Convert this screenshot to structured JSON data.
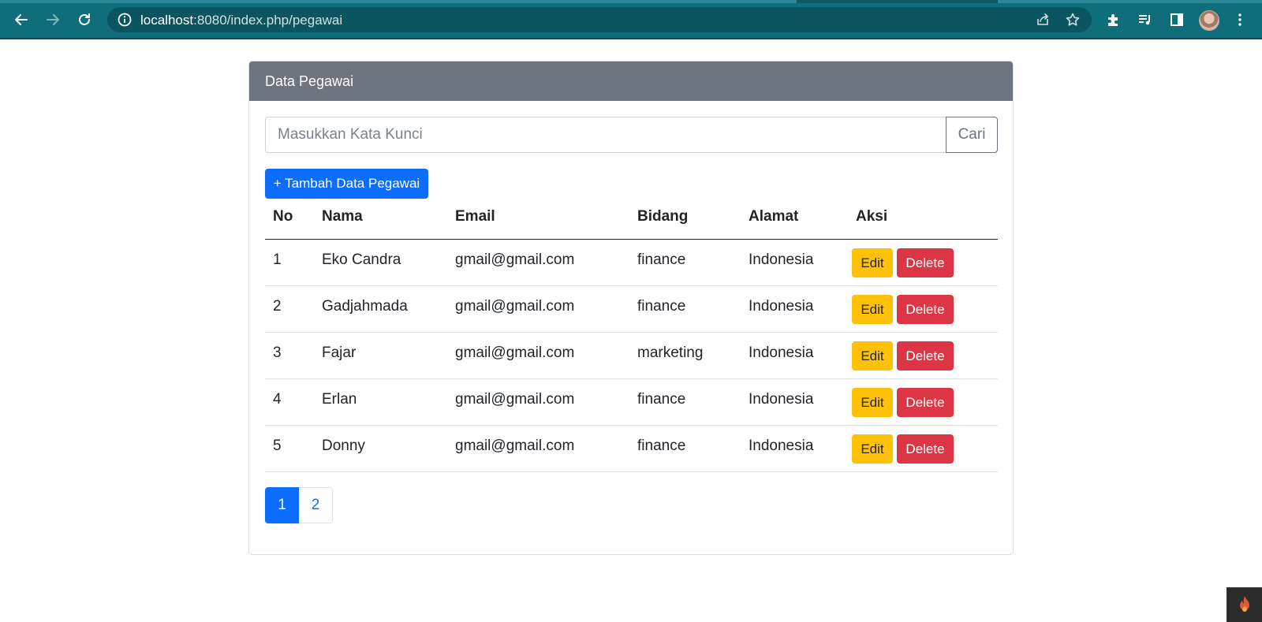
{
  "browser": {
    "url_host": "localhost",
    "url_rest": ":8080/index.php/pegawai"
  },
  "card": {
    "title": "Data Pegawai"
  },
  "search": {
    "placeholder": "Masukkan Kata Kunci",
    "button_label": "Cari"
  },
  "add_button_label": "+ Tambah Data Pegawai",
  "table": {
    "headers": [
      "No",
      "Nama",
      "Email",
      "Bidang",
      "Alamat",
      "Aksi"
    ],
    "rows": [
      {
        "no": "1",
        "nama": "Eko Candra",
        "email": "gmail@gmail.com",
        "bidang": "finance",
        "alamat": "Indonesia"
      },
      {
        "no": "2",
        "nama": "Gadjahmada",
        "email": "gmail@gmail.com",
        "bidang": "finance",
        "alamat": "Indonesia"
      },
      {
        "no": "3",
        "nama": "Fajar",
        "email": "gmail@gmail.com",
        "bidang": "marketing",
        "alamat": "Indonesia"
      },
      {
        "no": "4",
        "nama": "Erlan",
        "email": "gmail@gmail.com",
        "bidang": "finance",
        "alamat": "Indonesia"
      },
      {
        "no": "5",
        "nama": "Donny",
        "email": "gmail@gmail.com",
        "bidang": "finance",
        "alamat": "Indonesia"
      }
    ],
    "edit_label": "Edit",
    "delete_label": "Delete"
  },
  "pagination": {
    "pages": [
      "1",
      "2"
    ],
    "active": "1"
  },
  "icons": {
    "back": "arrow-left-icon",
    "forward": "arrow-right-icon",
    "reload": "reload-icon",
    "site_info": "info-icon",
    "share": "share-icon",
    "bookmark": "star-icon",
    "extensions": "puzzle-icon",
    "media": "playlist-icon",
    "side_panel": "side-panel-icon",
    "menu": "kebab-menu-icon",
    "debug_toolbar": "flame-icon"
  },
  "colors": {
    "chrome_bg": "#0e6e7a",
    "header_bg": "#6c757d",
    "primary": "#0d6efd",
    "warning": "#ffc107",
    "danger": "#dc3545"
  }
}
